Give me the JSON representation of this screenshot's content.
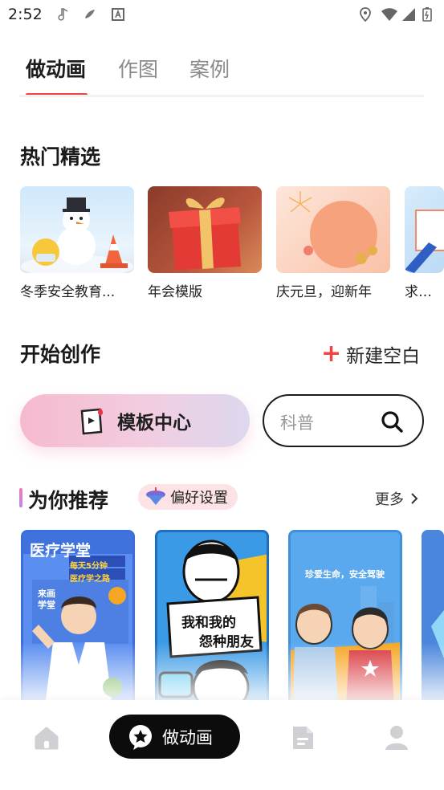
{
  "status_bar": {
    "time": "2:52",
    "left_icons": [
      "music-note-icon",
      "app-icon",
      "keyboard-icon"
    ],
    "right_icons": [
      "location-icon",
      "wifi-icon",
      "signal-icon",
      "battery-icon"
    ]
  },
  "tabs": [
    {
      "label": "做动画",
      "active": true
    },
    {
      "label": "作图",
      "active": false
    },
    {
      "label": "案例",
      "active": false
    }
  ],
  "hot_section": {
    "title": "热门精选",
    "items": [
      {
        "title": "冬季安全教育..."
      },
      {
        "title": "年会模版"
      },
      {
        "title": "庆元旦，迎新年"
      },
      {
        "title": "求职招"
      }
    ]
  },
  "create_section": {
    "title": "开始创作",
    "new_blank_label": "新建空白",
    "template_center_label": "模板中心",
    "search_placeholder": "科普"
  },
  "recommend_section": {
    "title": "为你推荐",
    "preference_label": "偏好设置",
    "more_label": "更多",
    "cards": [
      {
        "headline": "医疗学堂",
        "subline_1": "每天5分钟",
        "subline_2": "医疗学之路",
        "tag": "来画学堂"
      },
      {
        "headline_1": "我和我的",
        "headline_2": "怨种朋友"
      },
      {
        "headline": "珍爱生命，安全驾驶"
      },
      {
        "headline": ""
      }
    ]
  },
  "bottom_nav": {
    "items": [
      {
        "icon": "home-icon"
      },
      {
        "icon": "star-bubble-icon",
        "label": "做动画",
        "active": true
      },
      {
        "icon": "document-icon"
      },
      {
        "icon": "profile-icon"
      }
    ]
  },
  "colors": {
    "accent": "#f04444",
    "nav_active_bg": "#0c0c0c",
    "pref_bg": "#fde3e6"
  }
}
